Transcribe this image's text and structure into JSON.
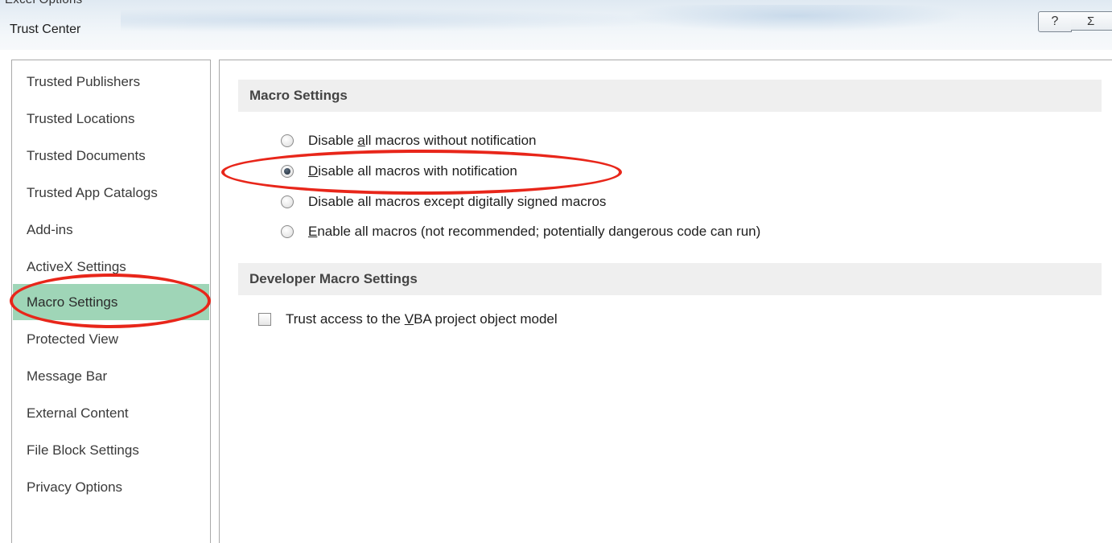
{
  "window": {
    "parent_title": "Excel Options",
    "title": "Trust Center",
    "help_icon": "?",
    "close_icon": "Σ"
  },
  "sidebar": {
    "items": [
      {
        "label": "Trusted Publishers",
        "selected": false
      },
      {
        "label": "Trusted Locations",
        "selected": false
      },
      {
        "label": "Trusted Documents",
        "selected": false
      },
      {
        "label": "Trusted App Catalogs",
        "selected": false
      },
      {
        "label": "Add-ins",
        "selected": false
      },
      {
        "label": "ActiveX Settings",
        "selected": false
      },
      {
        "label": "Macro Settings",
        "selected": true
      },
      {
        "label": "Protected View",
        "selected": false
      },
      {
        "label": "Message Bar",
        "selected": false
      },
      {
        "label": "External Content",
        "selected": false
      },
      {
        "label": "File Block Settings",
        "selected": false
      },
      {
        "label": "Privacy Options",
        "selected": false
      }
    ]
  },
  "macro_settings": {
    "header": "Macro Settings",
    "options": [
      {
        "pre": "Disable ",
        "accel": "a",
        "post": "ll macros without notification",
        "checked": false
      },
      {
        "pre": "",
        "accel": "D",
        "post": "isable all macros with notification",
        "checked": true
      },
      {
        "pre": "Disable all macros except di",
        "accel": "g",
        "post": "itally signed macros",
        "checked": false
      },
      {
        "pre": "",
        "accel": "E",
        "post": "nable all macros (not recommended; potentially dangerous code can run)",
        "checked": false
      }
    ]
  },
  "developer_settings": {
    "header": "Developer Macro Settings",
    "trust_vba": {
      "pre": "Trust access to the ",
      "accel": "V",
      "post": "BA project object model",
      "checked": false
    }
  },
  "colors": {
    "selected_bg": "#9fd5b7",
    "annotation": "#e8261a",
    "section_bg": "#efefef"
  }
}
